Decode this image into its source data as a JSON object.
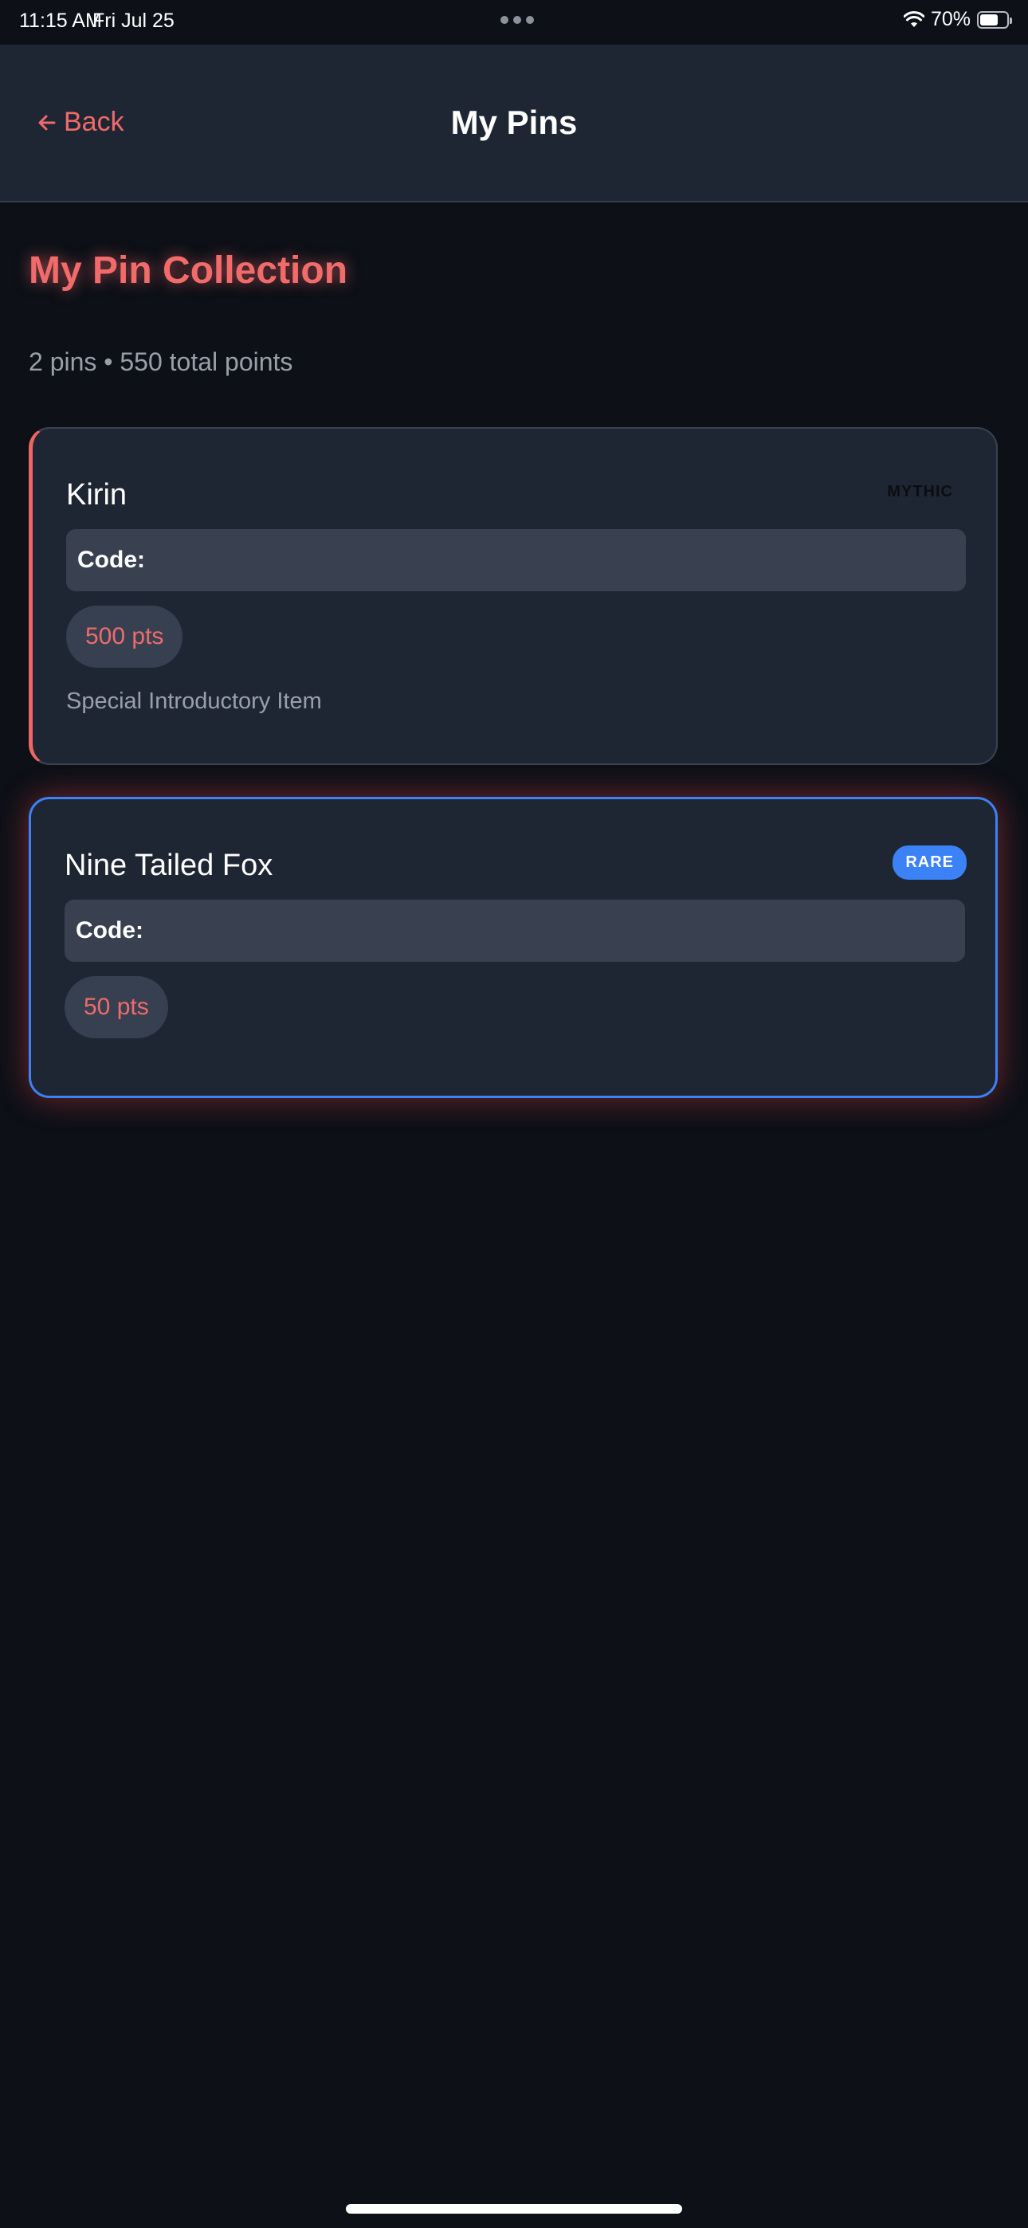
{
  "status_bar": {
    "time": "11:15 AM",
    "date": "Fri Jul 25",
    "battery": "70%",
    "battery_level": 0.7,
    "icons": [
      "wifi-icon",
      "battery-icon",
      "more-dots-icon"
    ]
  },
  "header": {
    "back_label": "Back",
    "title": "My Pins"
  },
  "collection": {
    "heading": "My Pin Collection",
    "summary": "2 pins • 550 total points"
  },
  "pins": [
    {
      "name": "Kirin",
      "rarity": "MYTHIC",
      "code_label": "Code:",
      "points": "500 pts",
      "description": "Special Introductory Item"
    },
    {
      "name": "Nine Tailed Fox",
      "rarity": "RARE",
      "code_label": "Code:",
      "points": "50 pts"
    }
  ],
  "colors": {
    "background": "#0d1017",
    "surface": "#1f2633",
    "accent_red": "#ef6a6a",
    "rare_blue": "#3b82f6",
    "muted_text": "#9aa0ab"
  }
}
